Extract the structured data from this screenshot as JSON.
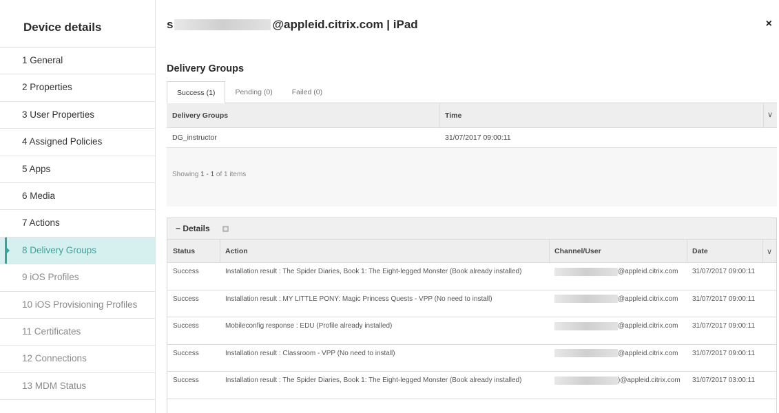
{
  "sidebar": {
    "title": "Device details",
    "items": [
      {
        "label": "1 General",
        "state": "normal"
      },
      {
        "label": "2 Properties",
        "state": "normal"
      },
      {
        "label": "3 User Properties",
        "state": "normal"
      },
      {
        "label": "4 Assigned Policies",
        "state": "normal"
      },
      {
        "label": "5 Apps",
        "state": "normal"
      },
      {
        "label": "6 Media",
        "state": "normal"
      },
      {
        "label": "7 Actions",
        "state": "normal"
      },
      {
        "label": "8 Delivery Groups",
        "state": "active"
      },
      {
        "label": "9 iOS Profiles",
        "state": "dim"
      },
      {
        "label": "10 iOS Provisioning Profiles",
        "state": "dim"
      },
      {
        "label": "11 Certificates",
        "state": "dim"
      },
      {
        "label": "12 Connections",
        "state": "dim"
      },
      {
        "label": "13 MDM Status",
        "state": "dim"
      }
    ]
  },
  "header": {
    "prefix": "s",
    "title": "@appleid.citrix.com | iPad",
    "close_icon": "×"
  },
  "section_title": "Delivery Groups",
  "tabs": [
    {
      "label": "Success (1)",
      "active": true
    },
    {
      "label": "Pending (0)",
      "active": false
    },
    {
      "label": "Failed (0)",
      "active": false
    }
  ],
  "delivery_table": {
    "columns": [
      "Delivery Groups",
      "Time"
    ],
    "rows": [
      [
        "DG_instructor",
        "31/07/2017 09:00:11"
      ]
    ],
    "showing": {
      "prefix": "Showing ",
      "range": "1 - 1",
      "suffix": " of 1 items"
    }
  },
  "details": {
    "label": "− Details",
    "columns": [
      "Status",
      "Action",
      "Channel/User",
      "Date"
    ],
    "rows": [
      {
        "status": "Success",
        "action": "Installation result : The Spider Diaries, Book 1: The Eight-legged Monster (Book already installed)",
        "user": "@appleid.citrix.com",
        "date": "31/07/2017 09:00:11"
      },
      {
        "status": "Success",
        "action": "Installation result : MY LITTLE PONY: Magic Princess Quests - VPP (No need to install)",
        "user": "@appleid.citrix.com",
        "date": "31/07/2017 09:00:11"
      },
      {
        "status": "Success",
        "action": "Mobileconfig response : EDU (Profile already installed)",
        "user": "@appleid.citrix.com",
        "date": "31/07/2017 09:00:11"
      },
      {
        "status": "Success",
        "action": "Installation result : Classroom - VPP (No need to install)",
        "user": "@appleid.citrix.com",
        "date": "31/07/2017 09:00:11"
      },
      {
        "status": "Success",
        "action": "Installation result : The Spider Diaries, Book 1: The Eight-legged Monster (Book already installed)",
        "user": ")@appleid.citrix.com",
        "date": "31/07/2017 03:00:11"
      }
    ]
  },
  "colors": {
    "accent": "#3aa39b",
    "active_bg": "#d5f0ee"
  }
}
